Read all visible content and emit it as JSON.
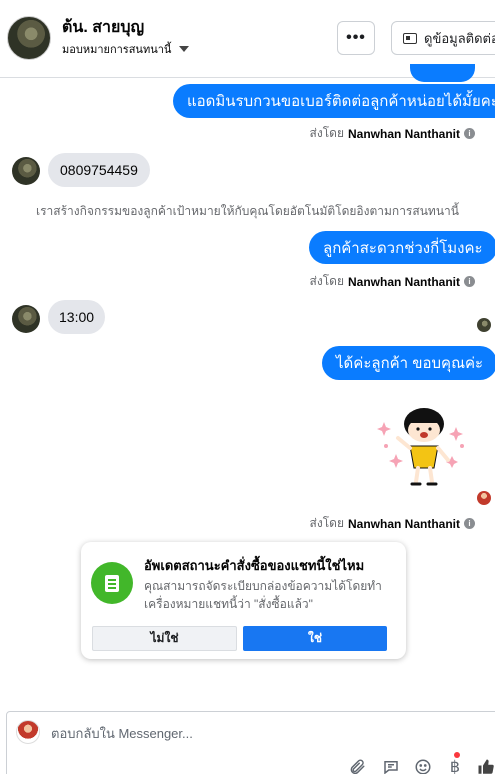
{
  "header": {
    "name": "ต้น. สายบุญ",
    "assign_label": "มอบหมายการสนทนานี้",
    "more_label": "•••",
    "contact_label": "ดูข้อมูลติดต่อ"
  },
  "messages": {
    "out_1": "แอดมินรบกวนขอเบอร์ติดต่อลูกค้าหน่อยได้มั้ยคะ",
    "in_1": "0809754459",
    "system_note": "เราสร้างกิจกรรมของลูกค้าเป้าหมายให้กับคุณโดยอัตโนมัติโดยอิงตามการสนทนานี้",
    "out_2": "ลูกค้าสะดวกช่วงกี่โมงคะ",
    "in_2": "13:00",
    "out_3": "ได้ค่ะลูกค้า ขอบคุณค่ะ"
  },
  "sent_by": {
    "prefix": "ส่งโดย",
    "name": "Nanwhan Nanthanit"
  },
  "status_card": {
    "title": "อัพเดตสถานะคำสั่งซื้อของแชทนี้ใช่ไหม",
    "description": "คุณสามารถจัดระเบียบกล่องข้อความได้โดยทำเครื่องหมายแชทนี้ว่า \"สั่งซื้อแล้ว\"",
    "no_label": "ไม่ใช่",
    "yes_label": "ใช่"
  },
  "composer": {
    "placeholder": "ตอบกลับใน Messenger..."
  },
  "colors": {
    "outgoing_bubble": "#0a7cff",
    "incoming_bubble": "#e4e6eb",
    "primary_button": "#1877f2",
    "status_icon": "#42b72a"
  },
  "icons": [
    "chevron-down-icon",
    "more-icon",
    "contact-card-icon",
    "info-icon",
    "receipt-icon",
    "attachment-icon",
    "saved-reply-icon",
    "emoji-icon",
    "payment-icon",
    "like-icon"
  ]
}
